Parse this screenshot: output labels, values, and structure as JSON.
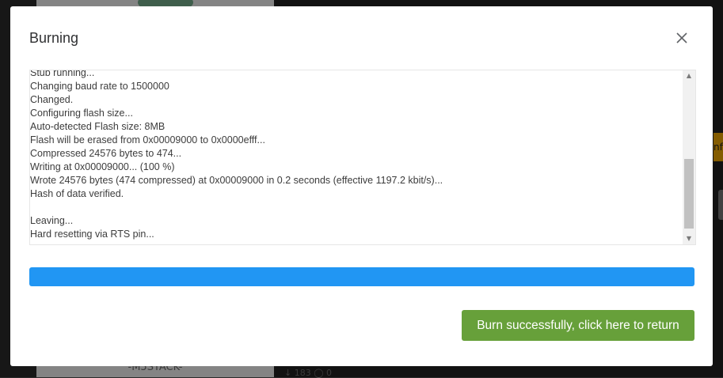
{
  "background": {
    "card_caption": "-M5STACK-",
    "meta_text": "↓ 183  ◯ 0",
    "right_tab_text": "nfi"
  },
  "dialog": {
    "title": "Burning",
    "close_icon": "close-icon",
    "log_lines": [
      "Stub running...",
      "Changing baud rate to 1500000",
      "Changed.",
      "Configuring flash size...",
      "Auto-detected Flash size: 8MB",
      "Flash will be erased from 0x00009000 to 0x0000efff...",
      "Compressed 24576 bytes to 474...",
      "Writing at 0x00009000... (100 %)",
      "Wrote 24576 bytes (474 compressed) at 0x00009000 in 0.2 seconds (effective 1197.2 kbit/s)...",
      "Hash of data verified.",
      "",
      "Leaving...",
      "Hard resetting via RTS pin..."
    ],
    "progress_percent": 100,
    "progress_color": "#2196f3",
    "return_button_label": "Burn successfully, click here to return",
    "return_button_color": "#67a03a"
  }
}
